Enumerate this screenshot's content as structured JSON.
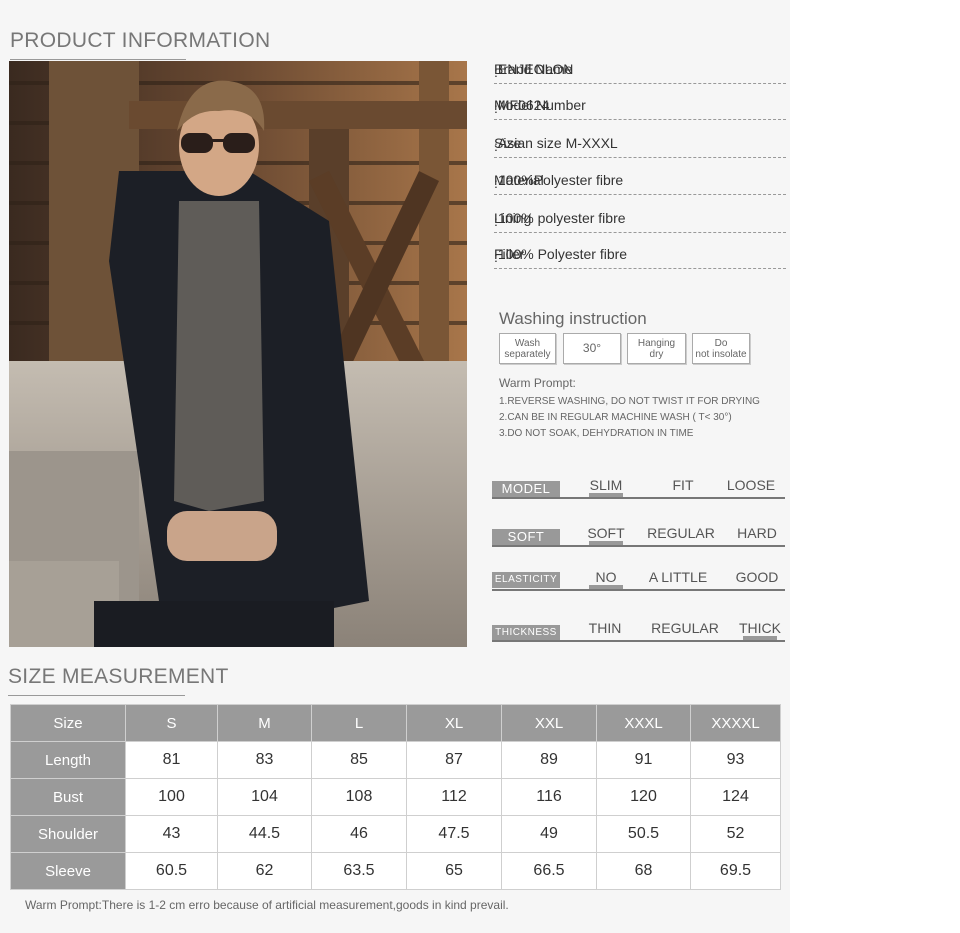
{
  "product_title": "PRODUCT INFORMATION",
  "specs": [
    {
      "label": "Brand Name",
      "value": "ENJEOLON"
    },
    {
      "label": "Model Number",
      "value": "MF0624"
    },
    {
      "label": "Size",
      "value": "Asian size M-XXXL"
    },
    {
      "label": "Material",
      "value": "100%Polyester fibre"
    },
    {
      "label": "Lining",
      "value": "100% polyester fibre"
    },
    {
      "label": "Filler",
      "value": "100% Polyester fibre"
    }
  ],
  "washing": {
    "title": "Washing instruction",
    "boxes": [
      "Wash separately",
      "30°",
      "Hanging dry",
      "Do not insolate"
    ],
    "prompt_title": "Warm Prompt:",
    "prompts": [
      "1.REVERSE WASHING, DO NOT TWIST IT FOR DRYING",
      "2.CAN BE IN REGULAR MACHINE WASH ( T< 30°)",
      "3.DO NOT SOAK, DEHYDRATION IN TIME"
    ]
  },
  "properties": [
    {
      "label": "MODEL",
      "options": [
        "SLIM",
        "FIT",
        "LOOSE"
      ],
      "selected": "SLIM"
    },
    {
      "label": "SOFT",
      "options": [
        "SOFT",
        "REGULAR",
        "HARD"
      ],
      "selected": "SOFT"
    },
    {
      "label": "ELASTICITY",
      "options": [
        "NO",
        "A LITTLE",
        "GOOD"
      ],
      "selected": "NO"
    },
    {
      "label": "THICKNESS",
      "options": [
        "THIN",
        "REGULAR",
        "THICK"
      ],
      "selected": "THICK"
    }
  ],
  "size_title": "SIZE MEASUREMENT",
  "size_table": {
    "headers": [
      "Size",
      "S",
      "M",
      "L",
      "XL",
      "XXL",
      "XXXL",
      "XXXXL"
    ],
    "rows": [
      {
        "name": "Length",
        "values": [
          "81",
          "83",
          "85",
          "87",
          "89",
          "91",
          "93"
        ]
      },
      {
        "name": "Bust",
        "values": [
          "100",
          "104",
          "108",
          "112",
          "116",
          "120",
          "124"
        ]
      },
      {
        "name": "Shoulder",
        "values": [
          "43",
          "44.5",
          "46",
          "47.5",
          "49",
          "50.5",
          "52"
        ]
      },
      {
        "name": "Sleeve",
        "values": [
          "60.5",
          "62",
          "63.5",
          "65",
          "66.5",
          "68",
          "69.5"
        ]
      }
    ]
  },
  "footnote": "Warm Prompt:There is 1-2 cm erro because of artificial measurement,goods in kind prevail."
}
